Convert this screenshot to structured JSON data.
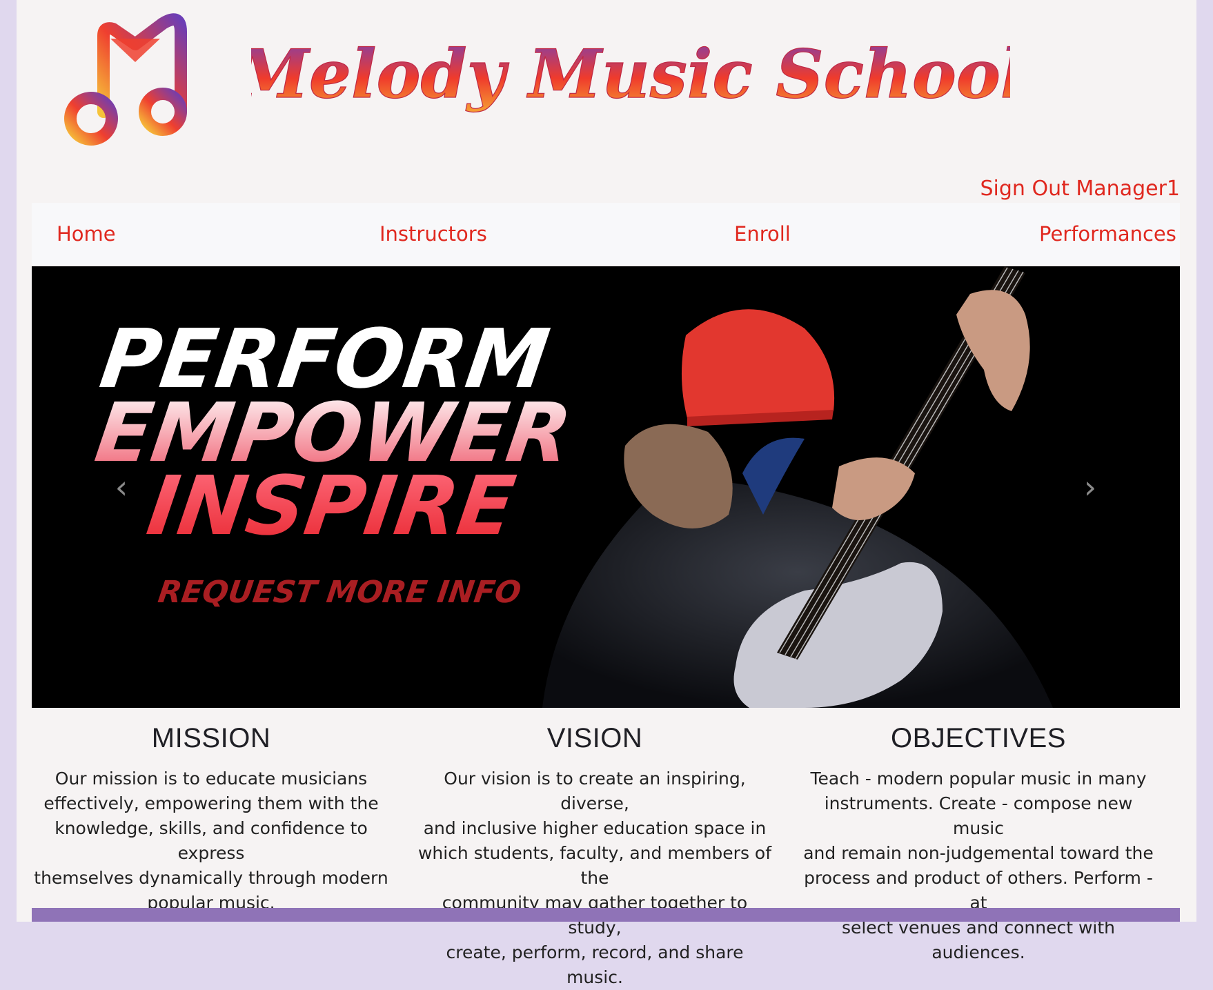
{
  "site": {
    "brand_title": "Melody Music School",
    "logo_letter": "M"
  },
  "auth": {
    "signout_label": "Sign Out Manager1"
  },
  "nav": {
    "items": [
      {
        "label": "Home"
      },
      {
        "label": "Instructors"
      },
      {
        "label": "Enroll"
      },
      {
        "label": "Performances"
      }
    ]
  },
  "hero": {
    "line1": "PERFORM",
    "line2": "EMPOWER",
    "line3": "INSPIRE",
    "cta": "REQUEST MORE INFO",
    "prev_icon": "‹",
    "next_icon": "›"
  },
  "sections": [
    {
      "title": "MISSION",
      "lines": [
        "Our mission is to educate musicians",
        "effectively, empowering them with the",
        "knowledge, skills, and confidence to express",
        "themselves dynamically through modern",
        "popular music."
      ]
    },
    {
      "title": "VISION",
      "lines": [
        "Our vision is to create an inspiring, diverse,",
        "and inclusive higher education space in",
        "which students, faculty, and members of the",
        "community may gather together to study,",
        "create, perform, record, and share music."
      ]
    },
    {
      "title": "OBJECTIVES",
      "lines": [
        "Teach - modern popular music in many",
        "instruments. Create - compose new music",
        "and remain non-judgemental toward the",
        "process and product of others. Perform - at",
        "select venues and connect with audiences."
      ]
    }
  ],
  "colors": {
    "accent": "#e0281f",
    "footer": "#8f73b7",
    "page_bg": "#f6f3f3",
    "outer_bg": "#e0d8ee"
  }
}
